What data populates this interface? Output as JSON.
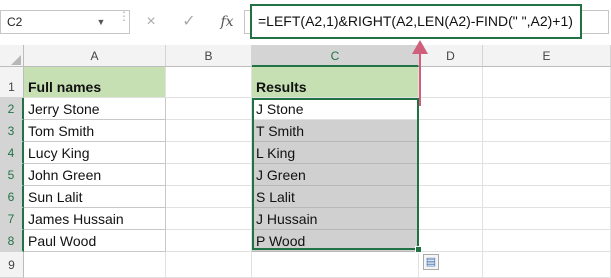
{
  "formula_bar": {
    "name_box": "C2",
    "cancel_icon": "×",
    "enter_icon": "✓",
    "fx_label": "fx",
    "formula": "=LEFT(A2,1)&RIGHT(A2,LEN(A2)-FIND(\" \",A2)+1)"
  },
  "columns": [
    "A",
    "B",
    "C",
    "D",
    "E"
  ],
  "rows": [
    "1",
    "2",
    "3",
    "4",
    "5",
    "6",
    "7",
    "8",
    "9"
  ],
  "colors": {
    "header_fill": "#c6e0b4",
    "selection": "#217346",
    "arrow": "#cf5f7a",
    "result_fill": "#d0d0d0"
  },
  "sheet": {
    "a_header": "Full names",
    "c_header": "Results",
    "names": [
      "Jerry Stone",
      "Tom Smith",
      "Lucy King",
      "John Green",
      "Sun Lalit",
      "James Hussain",
      "Paul Wood"
    ],
    "results": [
      "J Stone",
      "T Smith",
      "L King",
      "J Green",
      "S Lalit",
      "J Hussain",
      "P Wood"
    ]
  },
  "icons": {
    "quick_analysis": "quick-analysis-icon",
    "arrow": "up-arrow-icon"
  }
}
